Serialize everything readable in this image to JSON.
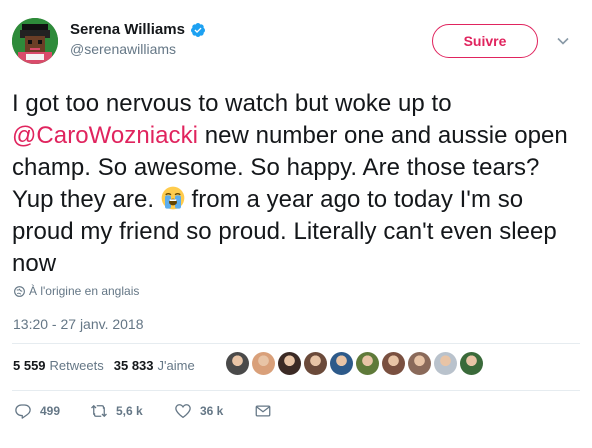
{
  "user": {
    "display_name": "Serena Williams",
    "handle": "@serenawilliams",
    "verified": true,
    "avatar_icon": "avatar-pixel-art"
  },
  "follow_button": {
    "label": "Suivre",
    "color": "#e0245e"
  },
  "menu_icon": "chevron-down-icon",
  "tweet": {
    "text_before_mention": "I got too nervous to watch but woke up to",
    "mention": "@CaroWozniacki",
    "text_after_mention": " new number one and aussie open champ. So awesome. So happy. Are those tears? Yup they are. ",
    "emoji": "crying-face-emoji",
    "text_after_emoji": " from a year ago to today I'm so proud my friend so proud. Literally can't even sleep now"
  },
  "translation_note": "À l'origine en anglais",
  "timestamp": "13:20 - 27 janv. 2018",
  "stats": {
    "retweets_count": "5 559",
    "retweets_label": "Retweets",
    "likes_count": "35 833",
    "likes_label": "J'aime"
  },
  "likers": [
    {
      "color": "#4a4a4a"
    },
    {
      "color": "#d9a07a"
    },
    {
      "color": "#3b2a25"
    },
    {
      "color": "#6b4a3a"
    },
    {
      "color": "#2d5a8a"
    },
    {
      "color": "#5f7a3a"
    },
    {
      "color": "#7a5040"
    },
    {
      "color": "#8a6a5a"
    },
    {
      "color": "#b9c2cc"
    },
    {
      "color": "#3a6a3a"
    }
  ],
  "actions": {
    "reply_count": "499",
    "retweet_count": "5,6 k",
    "like_count": "36 k"
  },
  "colors": {
    "accent": "#e0245e",
    "verified": "#1da1f2",
    "secondary_text": "#657786"
  }
}
